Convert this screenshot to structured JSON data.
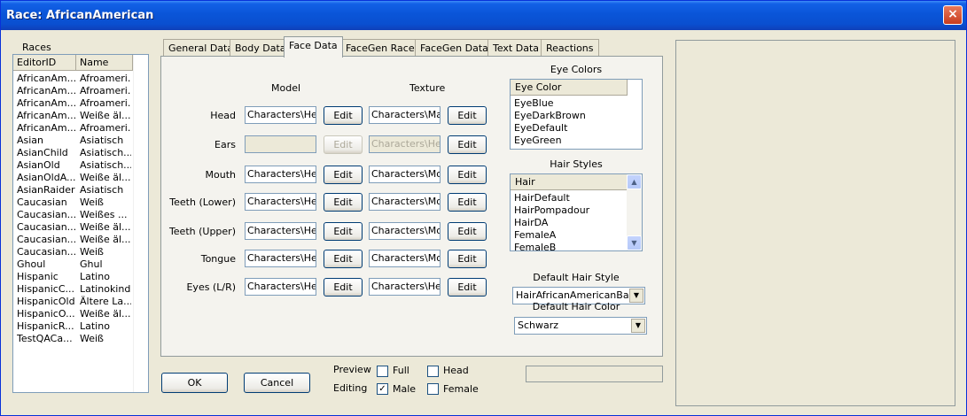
{
  "window": {
    "title": "Race: AfricanAmerican",
    "close_glyph": "×"
  },
  "races": {
    "label": "Races",
    "columns": [
      "EditorID",
      "Name"
    ],
    "rows": [
      [
        "AfricanAm...",
        "Afroameri..."
      ],
      [
        "AfricanAm...",
        "Afroameri..."
      ],
      [
        "AfricanAm...",
        "Afroameri..."
      ],
      [
        "AfricanAm...",
        "Weiße äl..."
      ],
      [
        "AfricanAm...",
        "Afroameri..."
      ],
      [
        "Asian",
        "Asiatisch"
      ],
      [
        "AsianChild",
        "Asiatisch..."
      ],
      [
        "AsianOld",
        "Asiatisch..."
      ],
      [
        "AsianOldA...",
        "Weiße äl..."
      ],
      [
        "AsianRaider",
        "Asiatisch"
      ],
      [
        "Caucasian",
        "Weiß"
      ],
      [
        "Caucasian...",
        "Weißes ..."
      ],
      [
        "Caucasian...",
        "Weiße äl..."
      ],
      [
        "Caucasian...",
        "Weiße äl..."
      ],
      [
        "Caucasian...",
        "Weiß"
      ],
      [
        "Ghoul",
        "Ghul"
      ],
      [
        "Hispanic",
        "Latino"
      ],
      [
        "HispanicC...",
        "Latinokind"
      ],
      [
        "HispanicOld",
        "Ältere La..."
      ],
      [
        "HispanicO...",
        "Weiße äl..."
      ],
      [
        "HispanicR...",
        "Latino"
      ],
      [
        "TestQACa...",
        "Weiß"
      ]
    ]
  },
  "tabs": [
    "General Data",
    "Body Data",
    "Face Data",
    "FaceGen Race",
    "FaceGen Data",
    "Text Data",
    "Reactions"
  ],
  "active_tab": "Face Data",
  "face": {
    "model_header": "Model",
    "texture_header": "Texture",
    "edit_label": "Edit",
    "rows": [
      {
        "label": "Head",
        "model": "Characters\\Hea",
        "texture": "Characters\\Mal",
        "model_enabled": true
      },
      {
        "label": "Ears",
        "model": "",
        "texture": "Characters\\Hea",
        "model_enabled": false
      },
      {
        "label": "Mouth",
        "model": "Characters\\Hea",
        "texture": "Characters\\Mou",
        "model_enabled": true
      },
      {
        "label": "Teeth (Lower)",
        "model": "Characters\\Hea",
        "texture": "Characters\\Mou",
        "model_enabled": true
      },
      {
        "label": "Teeth (Upper)",
        "model": "Characters\\Hea",
        "texture": "Characters\\Mou",
        "model_enabled": true
      },
      {
        "label": "Tongue",
        "model": "Characters\\Hea",
        "texture": "Characters\\Mou",
        "model_enabled": true
      },
      {
        "label": "Eyes (L/R)",
        "model": "Characters\\Hea",
        "texture": "Characters\\Hea",
        "model_enabled": true
      }
    ]
  },
  "eye_colors": {
    "title": "Eye Colors",
    "column": "Eye Color",
    "items": [
      "EyeBlue",
      "EyeDarkBrown",
      "EyeDefault",
      "EyeGreen"
    ]
  },
  "hair_styles": {
    "title": "Hair Styles",
    "column": "Hair",
    "items": [
      "HairDefault",
      "HairPompadour",
      "HairDA",
      "FemaleA",
      "FemaleB"
    ]
  },
  "default_hair_style": {
    "label": "Default Hair Style",
    "value": "HairAfricanAmericanBase"
  },
  "default_hair_color": {
    "label": "Default Hair Color",
    "value": "Schwarz"
  },
  "buttons": {
    "ok": "OK",
    "cancel": "Cancel"
  },
  "preview": {
    "label": "Preview",
    "full_label": "Full",
    "full_checked": false,
    "head_label": "Head",
    "head_checked": false
  },
  "editing": {
    "label": "Editing",
    "male_label": "Male",
    "male_checked": true,
    "female_label": "Female",
    "female_checked": false
  },
  "colors": {
    "title_bar": "#0a55d8",
    "window_bg": "#ece9d8",
    "panel_bg": "#f4f3ee"
  }
}
